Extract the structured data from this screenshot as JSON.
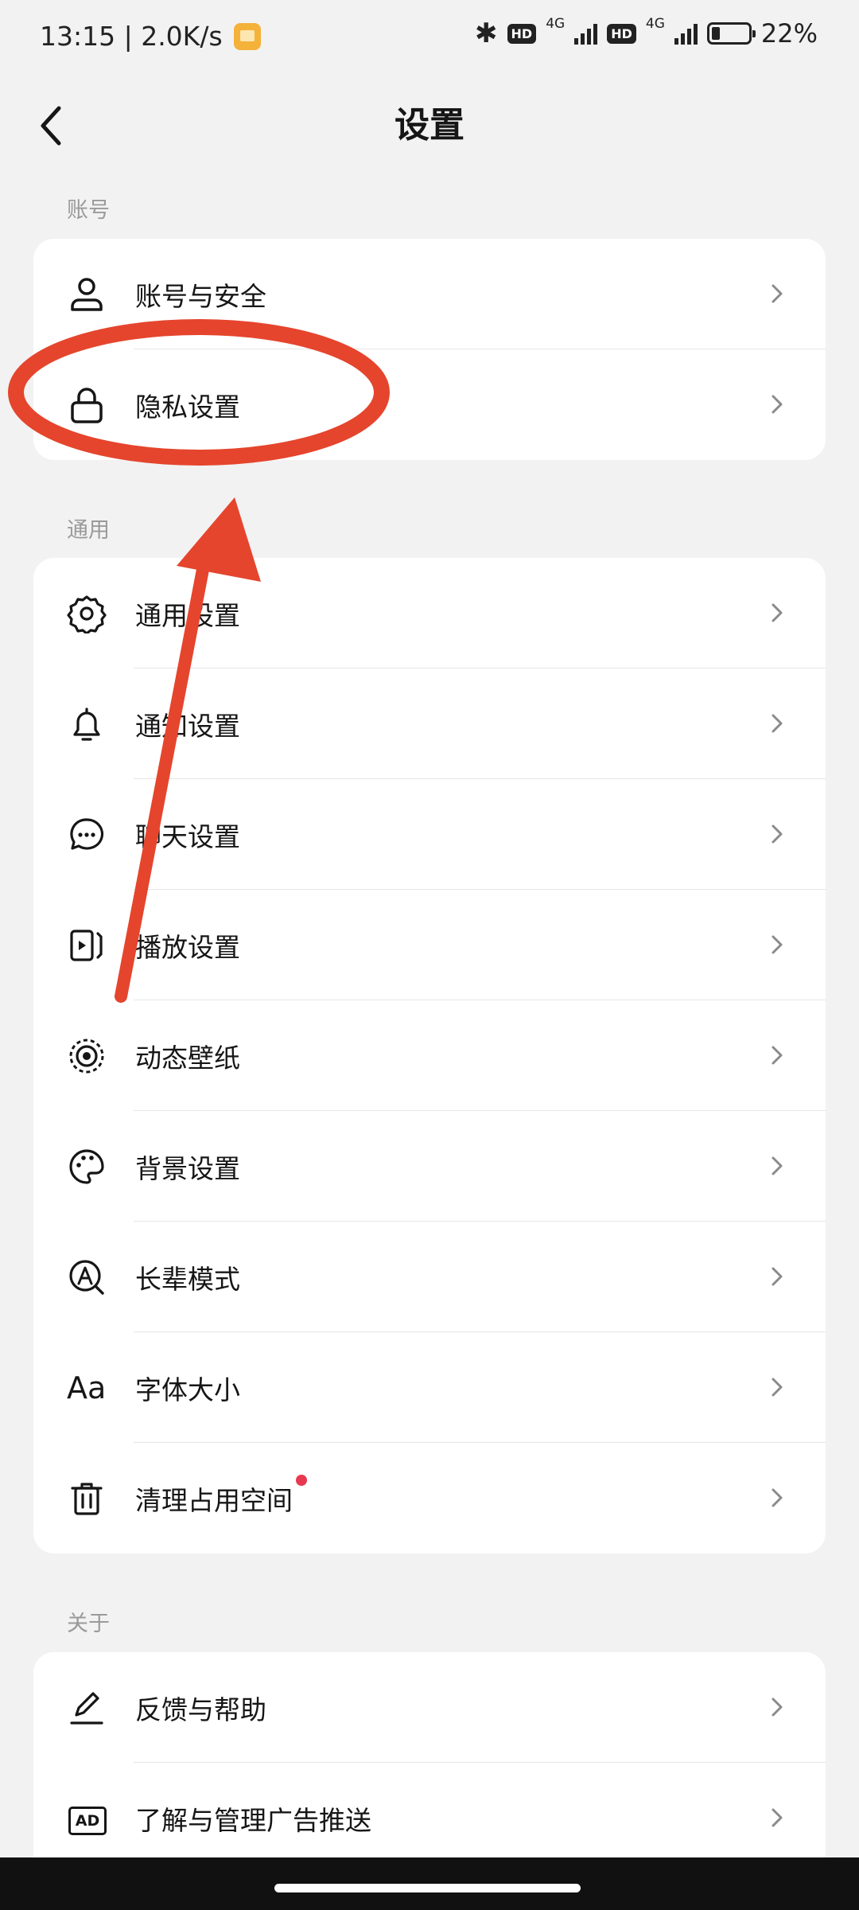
{
  "status_bar": {
    "time_speed": "13:15 | 2.0K/s",
    "hd1": "HD",
    "net1": "4G",
    "hd2": "HD",
    "net2": "4G",
    "battery_level": 0.22,
    "battery_text": "22%"
  },
  "header": {
    "title": "设置"
  },
  "sections": {
    "account": {
      "label": "账号",
      "items": [
        {
          "label": "账号与安全",
          "icon": "person-icon"
        },
        {
          "label": "隐私设置",
          "icon": "lock-icon"
        }
      ]
    },
    "general": {
      "label": "通用",
      "items": [
        {
          "label": "通用设置",
          "icon": "gear-icon"
        },
        {
          "label": "通知设置",
          "icon": "bell-icon"
        },
        {
          "label": "聊天设置",
          "icon": "chat-bubble-icon"
        },
        {
          "label": "播放设置",
          "icon": "play-screen-icon"
        },
        {
          "label": "动态壁纸",
          "icon": "live-wallpaper-icon"
        },
        {
          "label": "背景设置",
          "icon": "palette-icon"
        },
        {
          "label": "长辈模式",
          "icon": "elder-mode-icon"
        },
        {
          "label": "字体大小",
          "icon": "font-size-icon",
          "icon_text": "Aa"
        },
        {
          "label": "清理占用空间",
          "icon": "trash-icon",
          "badge": "red-dot"
        }
      ]
    },
    "about": {
      "label": "关于",
      "items": [
        {
          "label": "反馈与帮助",
          "icon": "edit-pen-icon"
        },
        {
          "label": "了解与管理广告推送",
          "icon": "ad-icon",
          "icon_text": "AD"
        }
      ]
    }
  },
  "annotation": {
    "color": "#e5452d",
    "target": "隐私设置"
  }
}
